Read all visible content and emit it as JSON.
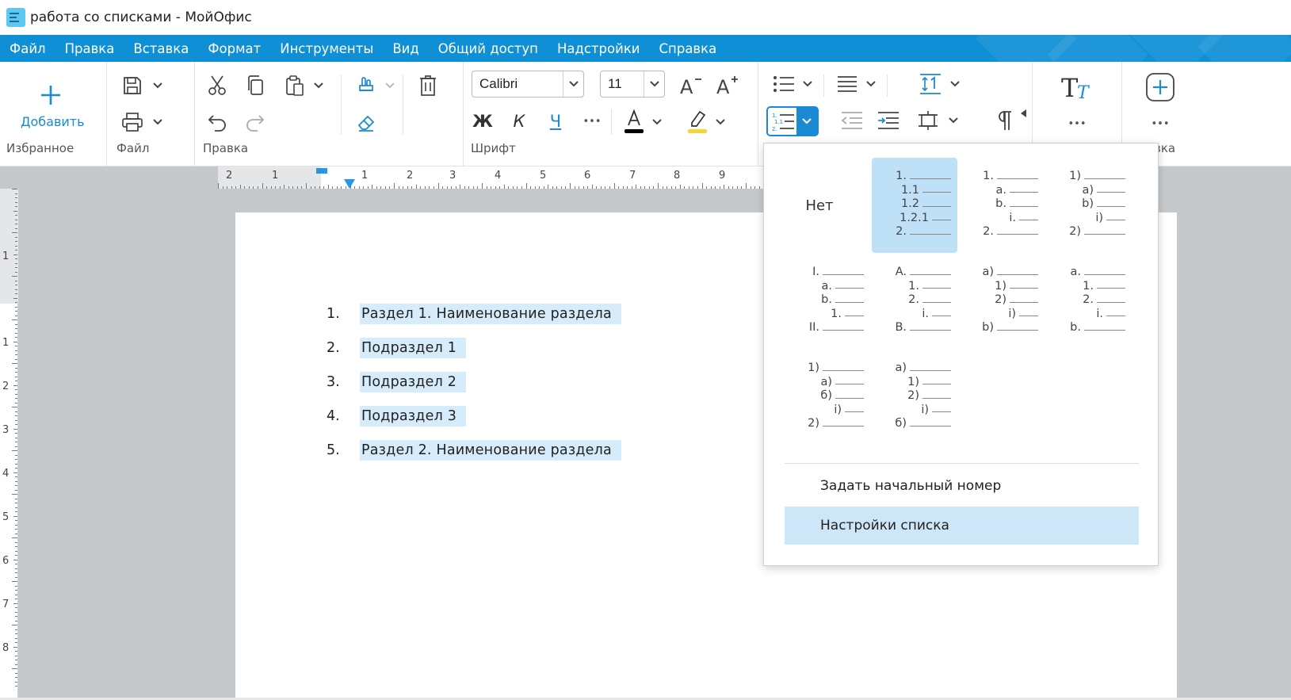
{
  "window": {
    "title": "работа со списками - МойОфис"
  },
  "menu": {
    "items": [
      "Файл",
      "Правка",
      "Вставка",
      "Формат",
      "Инструменты",
      "Вид",
      "Общий доступ",
      "Надстройки",
      "Справка"
    ]
  },
  "toolbar": {
    "favorites": {
      "add_label": "Добавить",
      "group_label": "Избранное"
    },
    "file": {
      "group_label": "Файл"
    },
    "edit": {
      "group_label": "Правка"
    },
    "font": {
      "group_label": "Шрифт",
      "family": "Calibri",
      "size": "11",
      "bold_label": "Ж",
      "italic_label": "К",
      "underline_label": "Ч",
      "more_label": "•••",
      "text_color": "#000000",
      "highlight_color": "#f5d63a"
    },
    "paragraph": {
      "overflow_label": "•••"
    },
    "styles": {
      "more_label": "•••"
    },
    "insert": {
      "group_label": "вка",
      "more_label": "•••"
    }
  },
  "ruler": {
    "horizontal_labels": [
      "2",
      "1",
      "1",
      "2",
      "3",
      "4",
      "5",
      "6",
      "7",
      "8",
      "9"
    ],
    "vertical_labels": [
      "1",
      "1",
      "2",
      "3",
      "4",
      "5",
      "6",
      "7",
      "8"
    ]
  },
  "document": {
    "items": [
      {
        "num": "1.",
        "text": "Раздел 1. Наименование раздела"
      },
      {
        "num": "2.",
        "text": "Подраздел 1"
      },
      {
        "num": "3.",
        "text": "Подраздел 2"
      },
      {
        "num": "4.",
        "text": "Подраздел 3"
      },
      {
        "num": "5.",
        "text": "Раздел 2. Наименование раздела"
      }
    ]
  },
  "numbering_menu": {
    "none_label": "Нет",
    "presets": [
      {
        "selected": true,
        "levels": [
          "1.",
          "1.1",
          "1.2",
          "1.2.1",
          "2."
        ]
      },
      {
        "selected": false,
        "levels": [
          "1.",
          "a.",
          "b.",
          "i.",
          "2."
        ]
      },
      {
        "selected": false,
        "levels": [
          "1)",
          "a)",
          "b)",
          "i)",
          "2)"
        ]
      },
      {
        "selected": false,
        "levels": [
          "I.",
          "a.",
          "b.",
          "1.",
          "II."
        ]
      },
      {
        "selected": false,
        "levels": [
          "A.",
          "1.",
          "2.",
          "i.",
          "B."
        ]
      },
      {
        "selected": false,
        "levels": [
          "a)",
          "1)",
          "2)",
          "i)",
          "b)"
        ]
      },
      {
        "selected": false,
        "levels": [
          "a.",
          "1.",
          "2.",
          "i.",
          "b."
        ]
      },
      {
        "selected": false,
        "levels": [
          "1)",
          "а)",
          "б)",
          "i)",
          "2)"
        ]
      },
      {
        "selected": false,
        "levels": [
          "а)",
          "1)",
          "2)",
          "i)",
          "б)"
        ]
      }
    ],
    "set_start_label": "Задать начальный номер",
    "list_settings_label": "Настройки списка"
  },
  "colors": {
    "accent": "#0f8fd6",
    "selection": "#bfe1f7",
    "text_highlight": "#d6ecfa"
  }
}
